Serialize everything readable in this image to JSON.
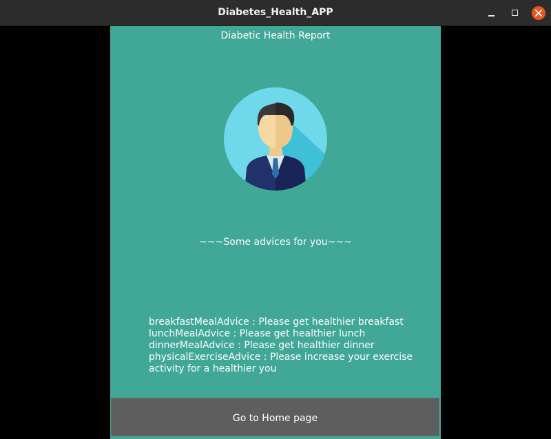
{
  "window": {
    "title": "Diabetes_Health_APP",
    "buttons": [
      "minimize",
      "maximize",
      "close"
    ]
  },
  "report": {
    "title": "Diabetic Health Report",
    "avatar_icon": "businessman-avatar-icon",
    "advice_heading": "~~~Some advices for you~~~",
    "advices": [
      {
        "key": "breakfastMealAdvice",
        "text": "breakfastMealAdvice :  Please get healthier breakfast"
      },
      {
        "key": "lunchMealAdvice",
        "text": "lunchMealAdvice :  Please get healthier lunch"
      },
      {
        "key": "dinnerMealAdvice",
        "text": "dinnerMealAdvice :  Please get healthier dinner"
      },
      {
        "key": "physicalExerciseAdvice",
        "text": "physicalExerciseAdvice :  Please increase your exercise activity for a healthier you"
      }
    ]
  },
  "actions": {
    "home_button_label": "Go to Home page"
  },
  "colors": {
    "titlebar": "#2c2c2c",
    "panel": "#41a797",
    "button": "#5e5e5e",
    "close": "#e9541f"
  }
}
